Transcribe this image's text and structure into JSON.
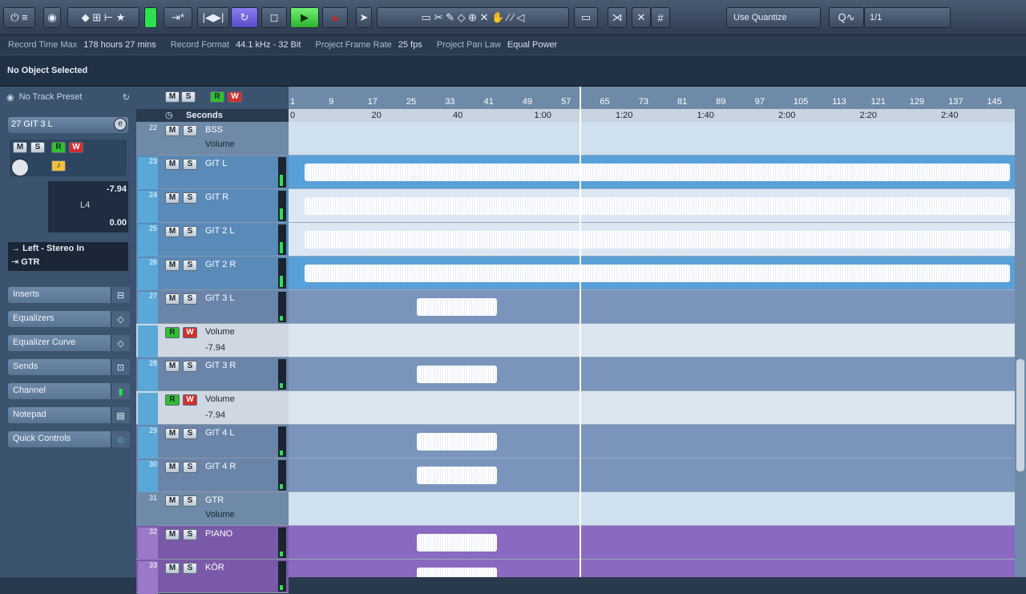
{
  "toolbar": {
    "quantize_mode": "Use Quantize",
    "quantize_value": "1/1"
  },
  "info": {
    "record_time_label": "Record Time Max",
    "record_time_value": "178 hours 27 mins",
    "record_format_label": "Record Format",
    "record_format_value": "44.1 kHz - 32 Bit",
    "frame_rate_label": "Project Frame Rate",
    "frame_rate_value": "25 fps",
    "pan_law_label": "Project Pan Law",
    "pan_law_value": "Equal Power"
  },
  "object_selection": "No Object Selected",
  "inspector": {
    "preset": "No Track Preset",
    "track_number": "27",
    "track_name": "GIT 3 L",
    "volume": "-7.94",
    "pan": "0.00",
    "pan_label": "L4",
    "input": "Left - Stereo In",
    "output": "GTR",
    "sections": [
      "Inserts",
      "Equalizers",
      "Equalizer Curve",
      "Sends",
      "Channel",
      "Notepad",
      "Quick Controls"
    ]
  },
  "tracklist_header": {
    "m": "M",
    "s": "S",
    "r": "R",
    "w": "W",
    "time_format": "Seconds"
  },
  "tracks": [
    {
      "num": "22",
      "name": "BSS",
      "type": "group",
      "sub": "Volume"
    },
    {
      "num": "23",
      "name": "GIT L",
      "type": "audio"
    },
    {
      "num": "24",
      "name": "GIT R",
      "type": "audio"
    },
    {
      "num": "25",
      "name": "GIT 2 L",
      "type": "audio"
    },
    {
      "num": "26",
      "name": "GIT 2 R",
      "type": "audio"
    },
    {
      "num": "27",
      "name": "GIT 3 L",
      "type": "audio"
    },
    {
      "num": "",
      "name": "Volume",
      "type": "auto",
      "value": "-7.94"
    },
    {
      "num": "28",
      "name": "GIT 3 R",
      "type": "audio"
    },
    {
      "num": "",
      "name": "Volume",
      "type": "auto",
      "value": "-7.94"
    },
    {
      "num": "29",
      "name": "GIT 4 L",
      "type": "audio"
    },
    {
      "num": "30",
      "name": "GIT 4 R",
      "type": "audio"
    },
    {
      "num": "31",
      "name": "GTR",
      "type": "group",
      "sub": "Volume"
    },
    {
      "num": "32",
      "name": "PIANO",
      "type": "audio"
    },
    {
      "num": "33",
      "name": "KÖR",
      "type": "audio"
    }
  ],
  "ruler": {
    "bars": [
      "1",
      "9",
      "17",
      "25",
      "33",
      "41",
      "49",
      "57",
      "65",
      "73",
      "81",
      "89",
      "97",
      "105",
      "113",
      "121",
      "129",
      "137",
      "145"
    ],
    "seconds": [
      "0",
      "20",
      "40",
      "1:00",
      "1:20",
      "1:40",
      "2:00",
      "2:20",
      "2:40"
    ]
  },
  "colors": {
    "accent": "#5aa8d8",
    "record": "#d03030"
  }
}
